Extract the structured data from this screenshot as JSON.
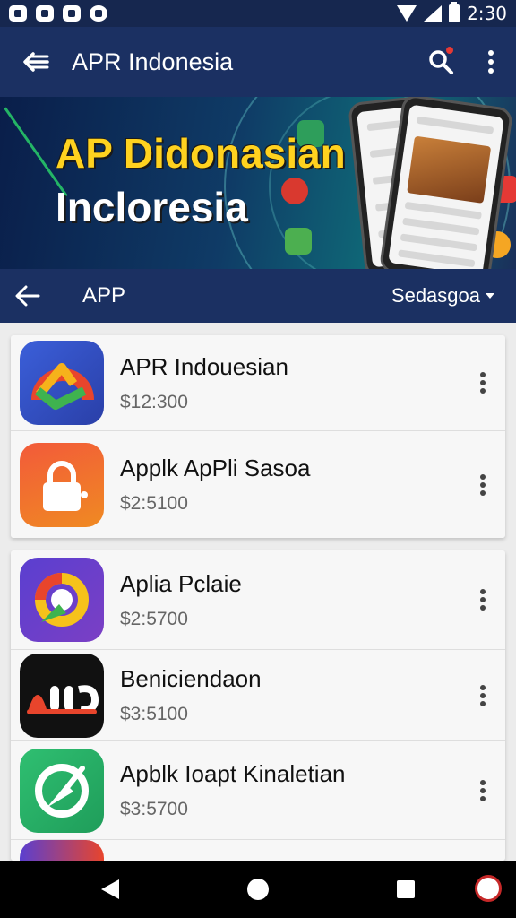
{
  "status_bar": {
    "time": "2:30",
    "left_icons": [
      "notification-icon",
      "photo-icon",
      "cast-icon",
      "chat-icon"
    ],
    "right_icons": [
      "wifi-icon",
      "signal-icon",
      "battery-icon"
    ]
  },
  "app_bar": {
    "title": "APR Indonesia",
    "icons": [
      "back-arrow-icon",
      "search-icon",
      "more-vert-icon"
    ]
  },
  "banner": {
    "title": "AP Didonasian",
    "subtitle": "Incloresia"
  },
  "sub_bar": {
    "title": "APP",
    "sort_label": "Sedasgoa"
  },
  "apps": [
    {
      "name": "APR Indouesian",
      "price": "$12:300",
      "icon": "multicolor-arch-icon"
    },
    {
      "name": "Applk ApPli Sasoa",
      "price": "$2:5100",
      "icon": "lock-bag-icon"
    },
    {
      "name": "Aplia Pclaie",
      "price": "$2:5700",
      "icon": "ring-icon"
    },
    {
      "name": "Beniciendaon",
      "price": "$3:5100",
      "icon": "aoc-logo-icon"
    },
    {
      "name": "Apblk Ioapt Kinaletian",
      "price": "$3:5700",
      "icon": "compass-icon"
    }
  ],
  "colors": {
    "status_bar": "#16274f",
    "app_bar": "#1b3062",
    "banner_title": "#ffd21f",
    "list_bg": "#ececec",
    "nav_bar": "#000000"
  },
  "nav_bar": {
    "icons": [
      "back-triangle-icon",
      "home-circle-icon",
      "recents-square-icon",
      "assist-icon"
    ]
  }
}
